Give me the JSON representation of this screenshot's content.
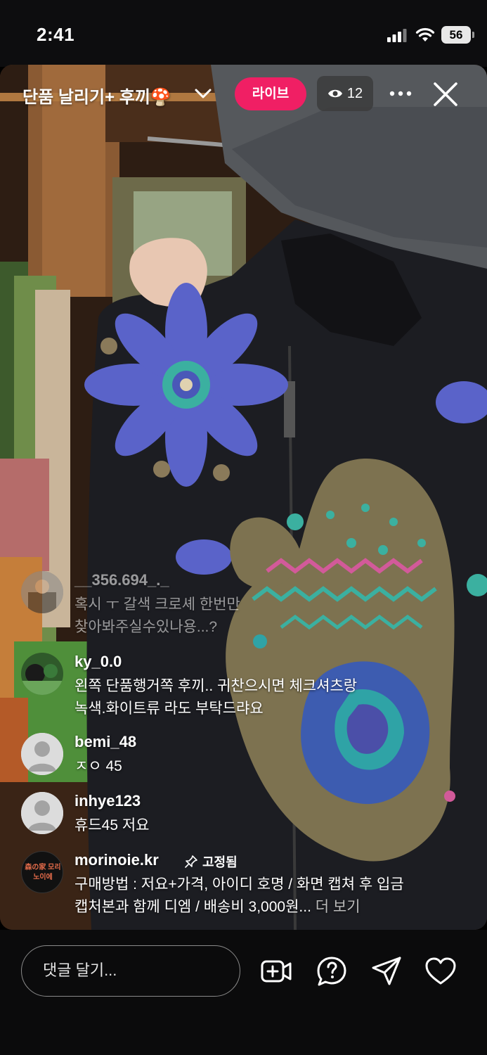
{
  "status_bar": {
    "time": "2:41",
    "battery": "56"
  },
  "header": {
    "title": "단품 날리기+ 후끼🍄",
    "live_label": "라이브",
    "viewer_count": "12"
  },
  "comments": [
    {
      "username": "__356.694_._",
      "lines": [
        "혹시 ㅜ 갈색 크로셰 한번만",
        "찾아봐주실수있나용...?"
      ]
    },
    {
      "username": "ky_0.0",
      "lines": [
        "왼쪽 단품행거쪽 후끼.. 귀찬으시면 체크셔츠랑",
        "녹색.화이트류 라도 부탁드랴요"
      ]
    },
    {
      "username": "bemi_48",
      "lines": [
        "ㅈㅇ 45"
      ]
    },
    {
      "username": "inhye123",
      "lines": [
        "휴드45 저요"
      ]
    }
  ],
  "pinned_comment": {
    "username": "morinoie.kr",
    "pinned_label": "고정됨",
    "avatar_text": "森の家 모리노이에",
    "line1": "구매방법 : 저요+가격, 아이디 호명 / 화면 캡쳐 후 입금",
    "line2": "캡처본과 함께 디엠 / 배송비 3,000원...",
    "more_label": "더 보기"
  },
  "bottom_bar": {
    "comment_placeholder": "댓글 달기..."
  },
  "colors": {
    "live_pink": "#f01f64",
    "background": "#0b0b0c"
  }
}
